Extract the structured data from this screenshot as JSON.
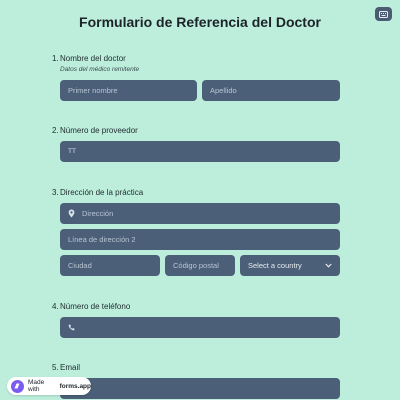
{
  "header": {
    "title": "Formulario de Referencia del Doctor"
  },
  "q1": {
    "number": "1.",
    "label": "Nombre del doctor",
    "sublabel": "Datos del médico remitente",
    "first_placeholder": "Primer nombre",
    "last_placeholder": "Apellido"
  },
  "q2": {
    "number": "2.",
    "label": "Número de proveedor",
    "field_icon_text": "TT"
  },
  "q3": {
    "number": "3.",
    "label": "Dirección de la práctica",
    "address_placeholder": "Dirección",
    "address2_placeholder": "Línea de dirección 2",
    "city_placeholder": "Ciudad",
    "postal_placeholder": "Código postal",
    "country_select": "Select a country"
  },
  "q4": {
    "number": "4.",
    "label": "Número de teléfono"
  },
  "q5": {
    "number": "5.",
    "label": "Email"
  },
  "badge": {
    "prefix": "Made with",
    "brand": "forms.app"
  },
  "icons": {
    "corner": "keyboard-icon",
    "address": "location-pin-icon",
    "phone": "phone-icon",
    "select": "chevron-down-icon",
    "badge": "forms-app-logo-icon"
  },
  "colors": {
    "background": "#bdeedb",
    "field": "#4b5f78",
    "badge_logo": "#7c5cf0"
  }
}
